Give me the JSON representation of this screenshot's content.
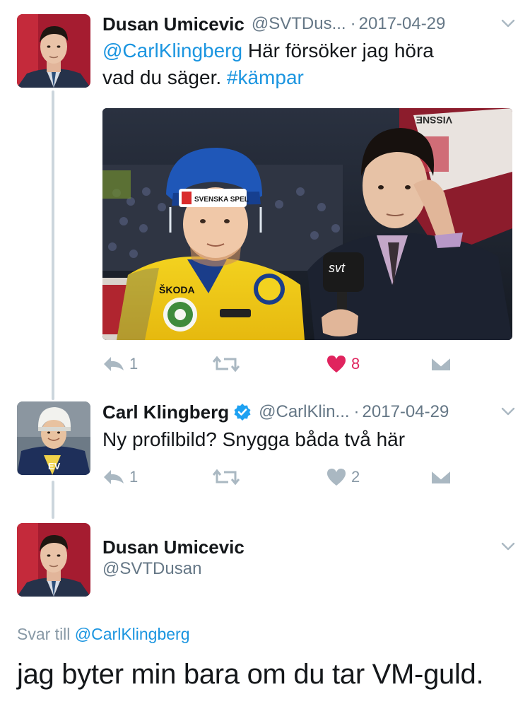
{
  "tweets": [
    {
      "name": "Dusan Umicevic",
      "handle": "@SVTDus...",
      "date": "2017-04-29",
      "mention": "@CarlKlingberg",
      "text_part1": " Här försöker jag höra",
      "text_part2": "vad du säger. ",
      "hashtag": "#kämpar",
      "actions": {
        "reply_count": "1",
        "like_count": "8",
        "liked": true
      }
    },
    {
      "name": "Carl Klingberg",
      "verified": true,
      "handle": "@CarlKlin...",
      "date": "2017-04-29",
      "text": "Ny profilbild? Snygga båda två här",
      "actions": {
        "reply_count": "1",
        "like_count": "2",
        "liked": false
      }
    }
  ],
  "focused": {
    "name": "Dusan Umicevic",
    "handle": "@SVTDusan",
    "reply_prefix": "Svar till ",
    "reply_target": "@CarlKlingberg",
    "text": "jag byter min bara om du tar VM-guld."
  },
  "media": {
    "helmet_brand": "SVENSKA SPEL",
    "jersey_sponsor": "ŠKODA",
    "mic_label": "svt",
    "banner_text": "VISSNE"
  },
  "colors": {
    "link": "#1b95e0",
    "like": "#e0245e",
    "muted": "#8899a6",
    "thread_line": "#ccd6dd"
  },
  "icons": [
    "reply-icon",
    "retweet-icon",
    "heart-icon",
    "dm-icon",
    "chevron-down-icon",
    "verified-badge-icon"
  ]
}
